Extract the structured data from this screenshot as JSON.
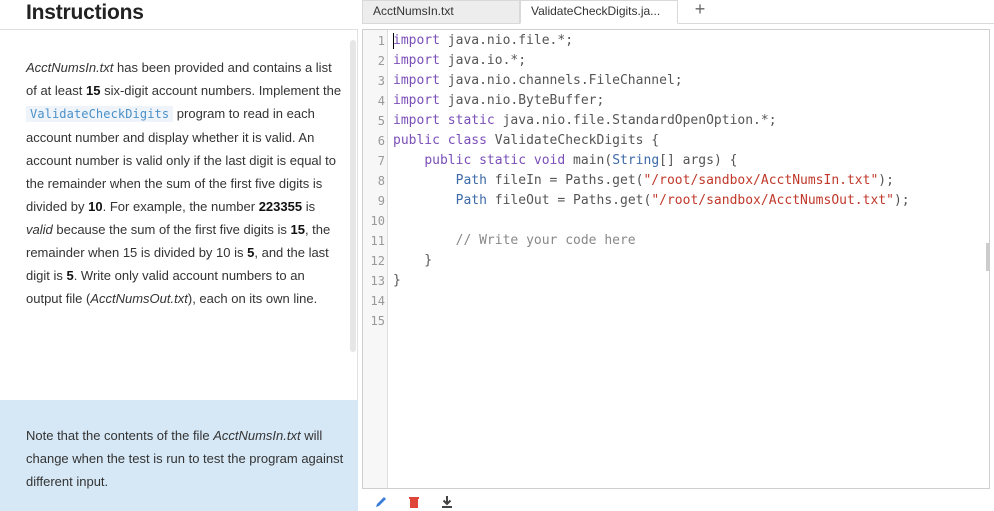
{
  "instructions": {
    "title": "Instructions",
    "p1_file": "AcctNumsIn.txt",
    "p1_a": " has been provided and contains a list of at least ",
    "p1_count": "15",
    "p1_b": " six-digit account numbers. Implement the ",
    "p1_program": "ValidateCheckDigits",
    "p1_c": " program to read in each account number and display whether it is valid. An account number is valid only if the last digit is equal to the remainder when the sum of the first five digits is divided by ",
    "p1_divisor": "10",
    "p1_d": ". For example, the number ",
    "p1_example": "223355",
    "p1_e": " is ",
    "p1_valid": "valid",
    "p1_f": " because the sum of the first five digits is ",
    "p1_sum": "15",
    "p1_g": ", the remainder when 15 is divided by 10 is ",
    "p1_rem": "5",
    "p1_h": ", and the last digit is ",
    "p1_last": "5",
    "p1_i": ". Write only valid account numbers to an output file (",
    "p1_outfile": "AcctNumsOut.txt",
    "p1_j": "), each on its own line.",
    "note_a": "Note that the contents of the file ",
    "note_file": "AcctNumsIn.txt",
    "note_b": " will change when the test is run to test the program against different input."
  },
  "tabs": [
    {
      "label": "AcctNumsIn.txt",
      "active": false
    },
    {
      "label": "ValidateCheckDigits.ja...",
      "active": true
    }
  ],
  "add_tab_label": "+",
  "editor": {
    "line_numbers": [
      "1",
      "2",
      "3",
      "4",
      "5",
      "6",
      "7",
      "8",
      "9",
      "10",
      "11",
      "12",
      "13",
      "14",
      "15"
    ],
    "lines": [
      "import java.nio.file.*;",
      "import java.io.*;",
      "import java.nio.channels.FileChannel;",
      "import java.nio.ByteBuffer;",
      "import static java.nio.file.StandardOpenOption.*;",
      "public class ValidateCheckDigits {",
      "    public static void main(String[] args) {",
      "        Path fileIn = Paths.get(\"/root/sandbox/AcctNumsIn.txt\");",
      "        Path fileOut = Paths.get(\"/root/sandbox/AcctNumsOut.txt\");",
      "",
      "        // Write your code here",
      "    }",
      "}",
      "",
      ""
    ]
  },
  "toolbar": {
    "icons": [
      "pencil-icon",
      "trash-icon",
      "download-icon"
    ]
  },
  "colors": {
    "note_bg": "#d6e8f6",
    "keyword": "#7a4fb8",
    "string": "#c0392b",
    "comment": "#888888",
    "pencil": "#3b7dd8",
    "trash": "#e0453a"
  }
}
